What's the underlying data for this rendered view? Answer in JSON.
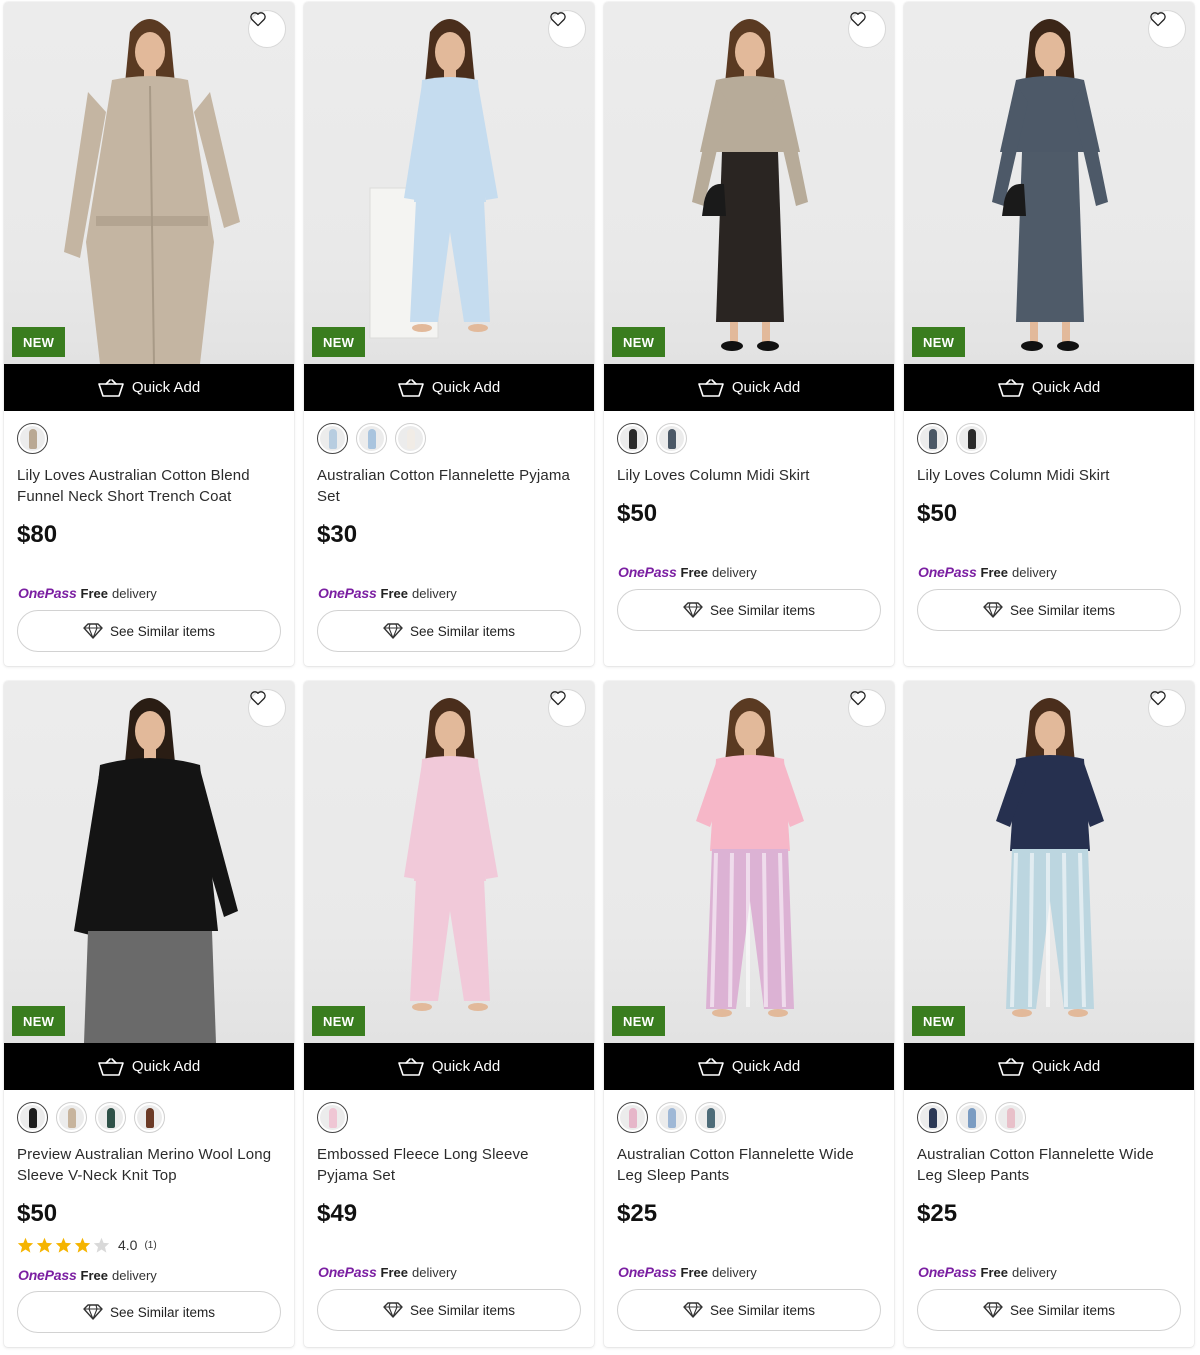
{
  "common": {
    "badge": "NEW",
    "quick_add": "Quick Add",
    "onepass": "OnePass",
    "free": "Free",
    "delivery": "delivery",
    "see_similar": "See Similar items"
  },
  "products": [
    {
      "title": "Lily Loves Australian Cotton Blend Funnel Neck Short Trench Coat",
      "price": "$80",
      "swatches": [
        "#b9a893"
      ],
      "rating": null,
      "photo": {
        "outfit": "coat",
        "top": "#c4b5a2",
        "bottom": "#c4b5a2",
        "hair": "#5a3a22",
        "prop": false
      }
    },
    {
      "title": "Australian Cotton Flannelette Pyjama Set",
      "price": "$30",
      "swatches": [
        "#b8cde0",
        "#a9c4de",
        "#f1ece6"
      ],
      "rating": null,
      "photo": {
        "outfit": "pyjama",
        "top": "#c5dcef",
        "bottom": "#c5dcef",
        "hair": "#4a2e1c",
        "prop": true
      }
    },
    {
      "title": "Lily Loves Column Midi Skirt",
      "price": "$50",
      "swatches": [
        "#2b2b2b",
        "#4b5866"
      ],
      "rating": null,
      "photo": {
        "outfit": "skirt",
        "top": "#b7ab99",
        "bottom": "#2a2522",
        "hair": "#5a3a22",
        "prop": false
      }
    },
    {
      "title": "Lily Loves Column Midi Skirt",
      "price": "$50",
      "swatches": [
        "#4b5866",
        "#2b2b2b"
      ],
      "rating": null,
      "photo": {
        "outfit": "skirt",
        "top": "#4d5968",
        "bottom": "#4f5b69",
        "hair": "#3b2618",
        "prop": false
      }
    },
    {
      "title": "Preview Australian Merino Wool Long Sleeve V-Neck Knit Top",
      "price": "$50",
      "swatches": [
        "#1c1c1c",
        "#c7b49d",
        "#2f5148",
        "#6b3a26"
      ],
      "rating": {
        "value": "4.0",
        "count": "(1)",
        "stars": 4
      },
      "photo": {
        "outfit": "knit",
        "top": "#141414",
        "bottom": "#6a6a6a",
        "hair": "#2a1d14",
        "prop": false
      }
    },
    {
      "title": "Embossed Fleece Long Sleeve Pyjama Set",
      "price": "$49",
      "swatches": [
        "#efc6d4"
      ],
      "rating": null,
      "photo": {
        "outfit": "pyjama",
        "top": "#f1c9d9",
        "bottom": "#f1c9d9",
        "hair": "#4a2e1c",
        "prop": false
      }
    },
    {
      "title": "Australian Cotton Flannelette Wide Leg Sleep Pants",
      "price": "$25",
      "swatches": [
        "#e6b6c9",
        "#9fb8d6",
        "#4d6b78"
      ],
      "rating": null,
      "photo": {
        "outfit": "tee",
        "top": "#f6b7c8",
        "bottom": "#dcb2d4",
        "hair": "#5a3a22",
        "prop": false
      }
    },
    {
      "title": "Australian Cotton Flannelette Wide Leg Sleep Pants",
      "price": "$25",
      "swatches": [
        "#2c3956",
        "#7b9cc2",
        "#e8c0c9"
      ],
      "rating": null,
      "photo": {
        "outfit": "tee",
        "top": "#26304f",
        "bottom": "#bcd6e0",
        "hair": "#4a2e1c",
        "prop": false
      }
    }
  ]
}
